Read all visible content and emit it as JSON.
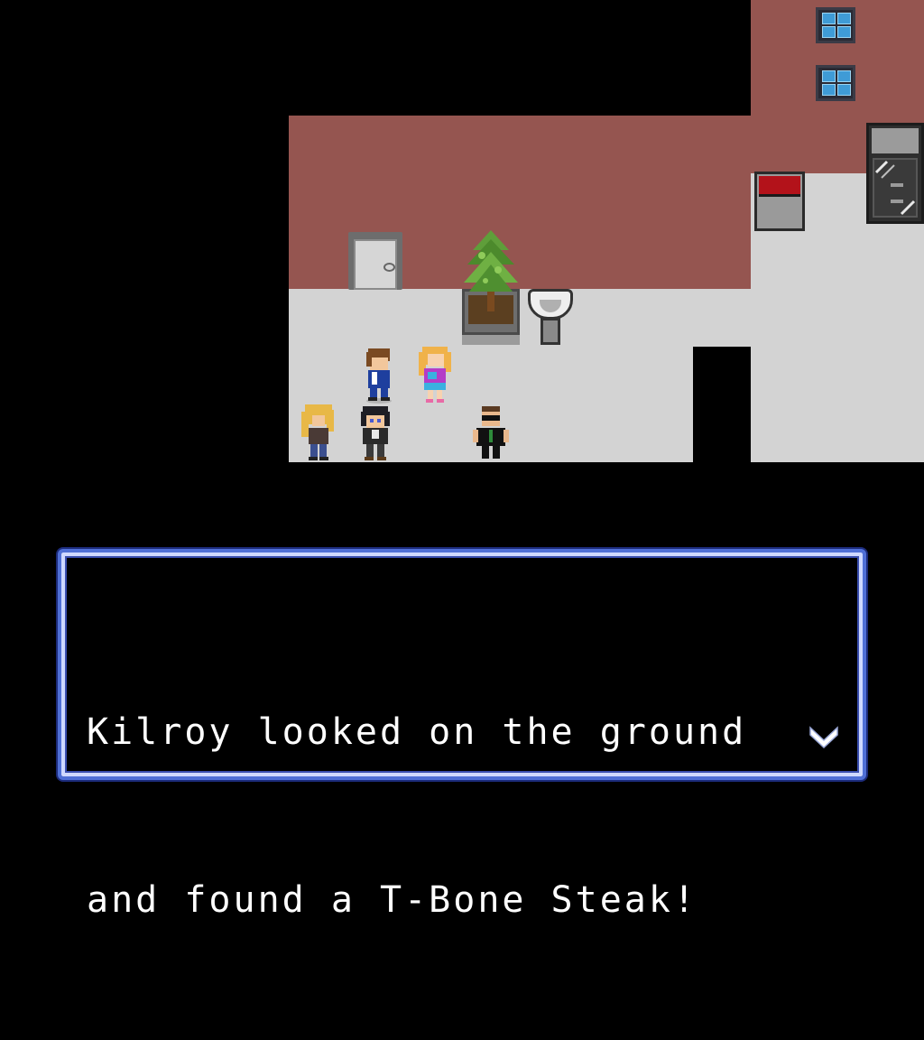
{
  "dialog": {
    "line1": "Kilroy looked on the ground",
    "line2": "and found a T-Bone Steak!",
    "advance_icon": "chevron-down-icon"
  },
  "scene": {
    "colors": {
      "wall": "#955550",
      "floor": "#d3d3d3",
      "void": "#000000",
      "dialog_border": "#4f6fd6"
    },
    "icons": [
      "window-icon",
      "door-icon",
      "potted-tree-icon",
      "sink-icon",
      "tv-icon",
      "fridge-icon"
    ],
    "characters": [
      "blonde-character",
      "black-hair-character",
      "brown-hair-character",
      "girl-character",
      "sunglasses-character"
    ]
  }
}
